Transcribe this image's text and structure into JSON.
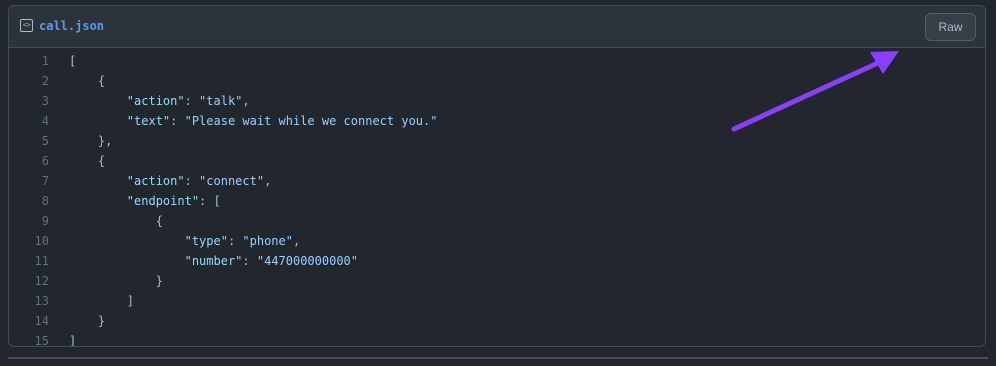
{
  "file": {
    "icon": "code-file-icon",
    "name": "call.json",
    "raw_label": "Raw"
  },
  "code": {
    "lines": [
      [
        {
          "t": "pun",
          "v": "["
        }
      ],
      [
        {
          "t": "pun",
          "v": "    {"
        }
      ],
      [
        {
          "t": "pun",
          "v": "        "
        },
        {
          "t": "key",
          "v": "\"action\""
        },
        {
          "t": "pun",
          "v": ": "
        },
        {
          "t": "str",
          "v": "\"talk\""
        },
        {
          "t": "pun",
          "v": ","
        }
      ],
      [
        {
          "t": "pun",
          "v": "        "
        },
        {
          "t": "key",
          "v": "\"text\""
        },
        {
          "t": "pun",
          "v": ": "
        },
        {
          "t": "str",
          "v": "\"Please wait while we connect you.\""
        }
      ],
      [
        {
          "t": "pun",
          "v": "    },"
        }
      ],
      [
        {
          "t": "pun",
          "v": "    {"
        }
      ],
      [
        {
          "t": "pun",
          "v": "        "
        },
        {
          "t": "key",
          "v": "\"action\""
        },
        {
          "t": "pun",
          "v": ": "
        },
        {
          "t": "str",
          "v": "\"connect\""
        },
        {
          "t": "pun",
          "v": ","
        }
      ],
      [
        {
          "t": "pun",
          "v": "        "
        },
        {
          "t": "key",
          "v": "\"endpoint\""
        },
        {
          "t": "pun",
          "v": ": ["
        }
      ],
      [
        {
          "t": "pun",
          "v": "            {"
        }
      ],
      [
        {
          "t": "pun",
          "v": "                "
        },
        {
          "t": "key",
          "v": "\"type\""
        },
        {
          "t": "pun",
          "v": ": "
        },
        {
          "t": "str",
          "v": "\"phone\""
        },
        {
          "t": "pun",
          "v": ","
        }
      ],
      [
        {
          "t": "pun",
          "v": "                "
        },
        {
          "t": "key",
          "v": "\"number\""
        },
        {
          "t": "pun",
          "v": ": "
        },
        {
          "t": "str",
          "v": "\"447000000000\""
        }
      ],
      [
        {
          "t": "pun",
          "v": "            }"
        }
      ],
      [
        {
          "t": "pun",
          "v": "        ]"
        }
      ],
      [
        {
          "t": "pun",
          "v": "    }"
        }
      ],
      [
        {
          "t": "pun",
          "v": "]"
        }
      ]
    ]
  },
  "annotation": {
    "icon": "arrow-pointer-icon",
    "color": "#8a3ffc"
  },
  "colors": {
    "background": "#22272e",
    "header": "#2d333b",
    "border": "#444c56",
    "filename": "#539bf5",
    "key": "#8ddbfd",
    "string": "#96d0ff",
    "line_number": "#636e7b"
  }
}
